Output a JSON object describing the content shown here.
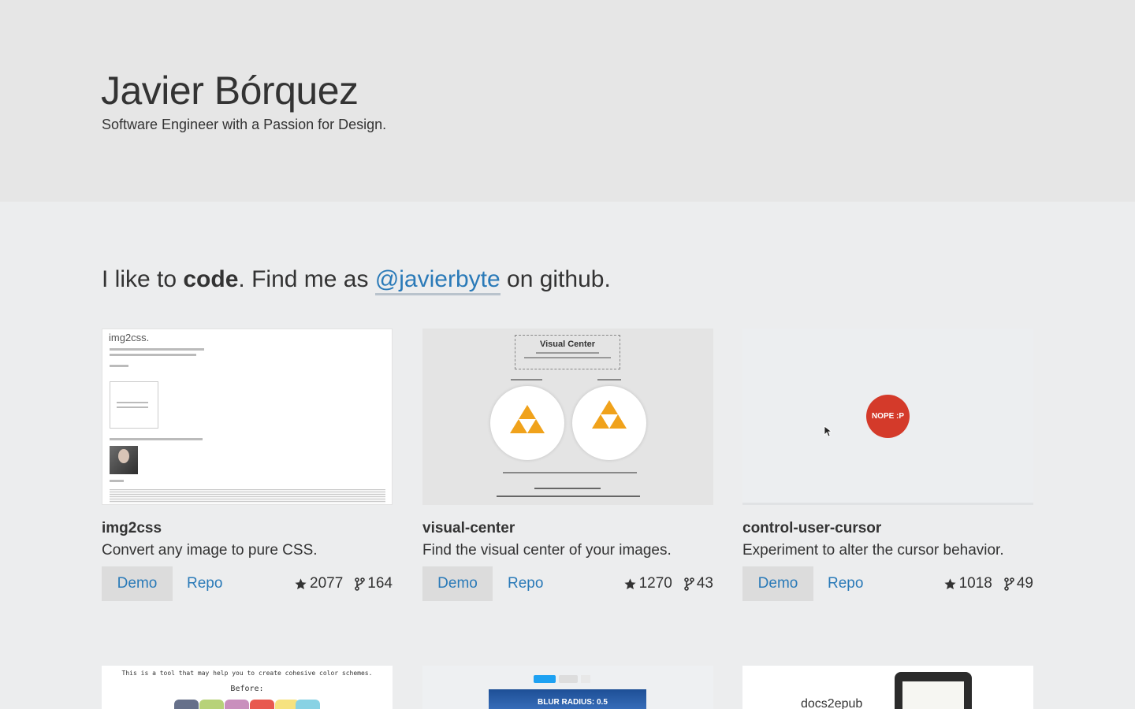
{
  "hero": {
    "name": "Javier Bórquez",
    "tagline": "Software Engineer with a Passion for Design."
  },
  "intro": {
    "part1": "I like to ",
    "bold": "code",
    "part2": ". Find me as ",
    "handle": "@javierbyte",
    "part3": " on github."
  },
  "projects": [
    {
      "title": "img2css",
      "description": "Convert any image to pure CSS.",
      "demo_label": "Demo",
      "repo_label": "Repo",
      "stars": "2077",
      "forks": "164",
      "thumb_title": "img2css."
    },
    {
      "title": "visual-center",
      "description": "Find the visual center of your images.",
      "demo_label": "Demo",
      "repo_label": "Repo",
      "stars": "1270",
      "forks": "43",
      "thumb_title": "Visual Center"
    },
    {
      "title": "control-user-cursor",
      "description": "Experiment to alter the cursor behavior.",
      "demo_label": "Demo",
      "repo_label": "Repo",
      "stars": "1018",
      "forks": "49",
      "thumb_badge": "NOPE :P"
    }
  ],
  "next_row": {
    "thumb1_line1": "This is a tool that may help you to create cohesive color schemes.",
    "thumb1_line2": "Before:",
    "thumb2_text": "BLUR RADIUS: 0.5",
    "thumb3_text": "docs2epub"
  },
  "colors": {
    "accent": "#2a7ab8",
    "hero_bg": "#e6e6e6",
    "page_bg": "#ecedee",
    "nope": "#d43a2a",
    "triangle": "#f0a21b"
  },
  "icons": {
    "star": "star-icon",
    "fork": "fork-icon"
  }
}
